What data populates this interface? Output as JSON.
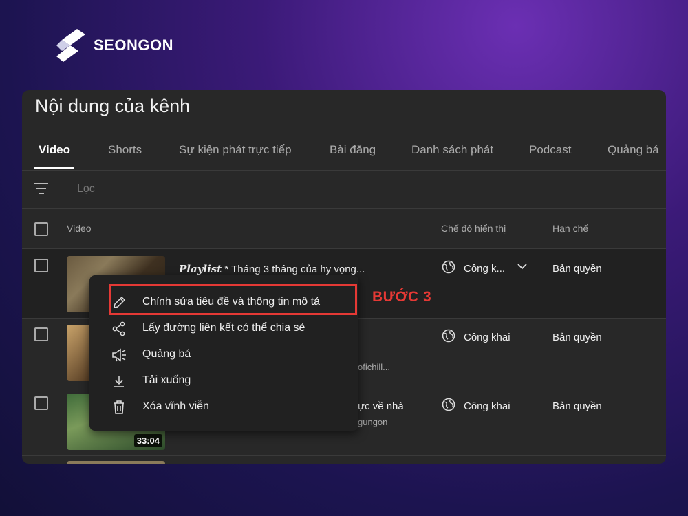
{
  "brand": {
    "name": "SEONGON"
  },
  "page": {
    "title": "Nội dung của kênh"
  },
  "tabs": [
    {
      "label": "Video",
      "active": true
    },
    {
      "label": "Shorts"
    },
    {
      "label": "Sự kiện phát trực tiếp"
    },
    {
      "label": "Bài đăng"
    },
    {
      "label": "Danh sách phát"
    },
    {
      "label": "Podcast"
    },
    {
      "label": "Quảng bá"
    }
  ],
  "filter": {
    "placeholder": "Lọc"
  },
  "table": {
    "columns": {
      "video": "Video",
      "visibility": "Chế độ hiển thị",
      "restrictions": "Hạn chế"
    },
    "rows": [
      {
        "title_prefix": "Playlist",
        "title": " * Tháng 3 tháng của hy vọng...",
        "visibility": "Công k...",
        "restriction": "Bản quyền",
        "description": "",
        "duration": ""
      },
      {
        "title_prefix": "",
        "title": "",
        "visibility": "Công khai",
        "restriction": "Bản quyền",
        "description": "ofichill...",
        "duration": ""
      },
      {
        "title_prefix": "",
        "title": "ực về nhà",
        "visibility": "Công khai",
        "restriction": "Bản quyền",
        "description": "gungon",
        "duration": "33:04"
      }
    ]
  },
  "context_menu": {
    "items": [
      {
        "label": "Chỉnh sửa tiêu đề và thông tin mô tả",
        "icon": "pencil-icon"
      },
      {
        "label": "Lấy đường liên kết có thể chia sẻ",
        "icon": "share-icon"
      },
      {
        "label": "Quảng bá",
        "icon": "megaphone-icon"
      },
      {
        "label": "Tải xuống",
        "icon": "download-icon"
      },
      {
        "label": "Xóa vĩnh viễn",
        "icon": "trash-icon"
      }
    ]
  },
  "annotation": {
    "step": "BƯỚC 3",
    "color": "#e53935"
  }
}
